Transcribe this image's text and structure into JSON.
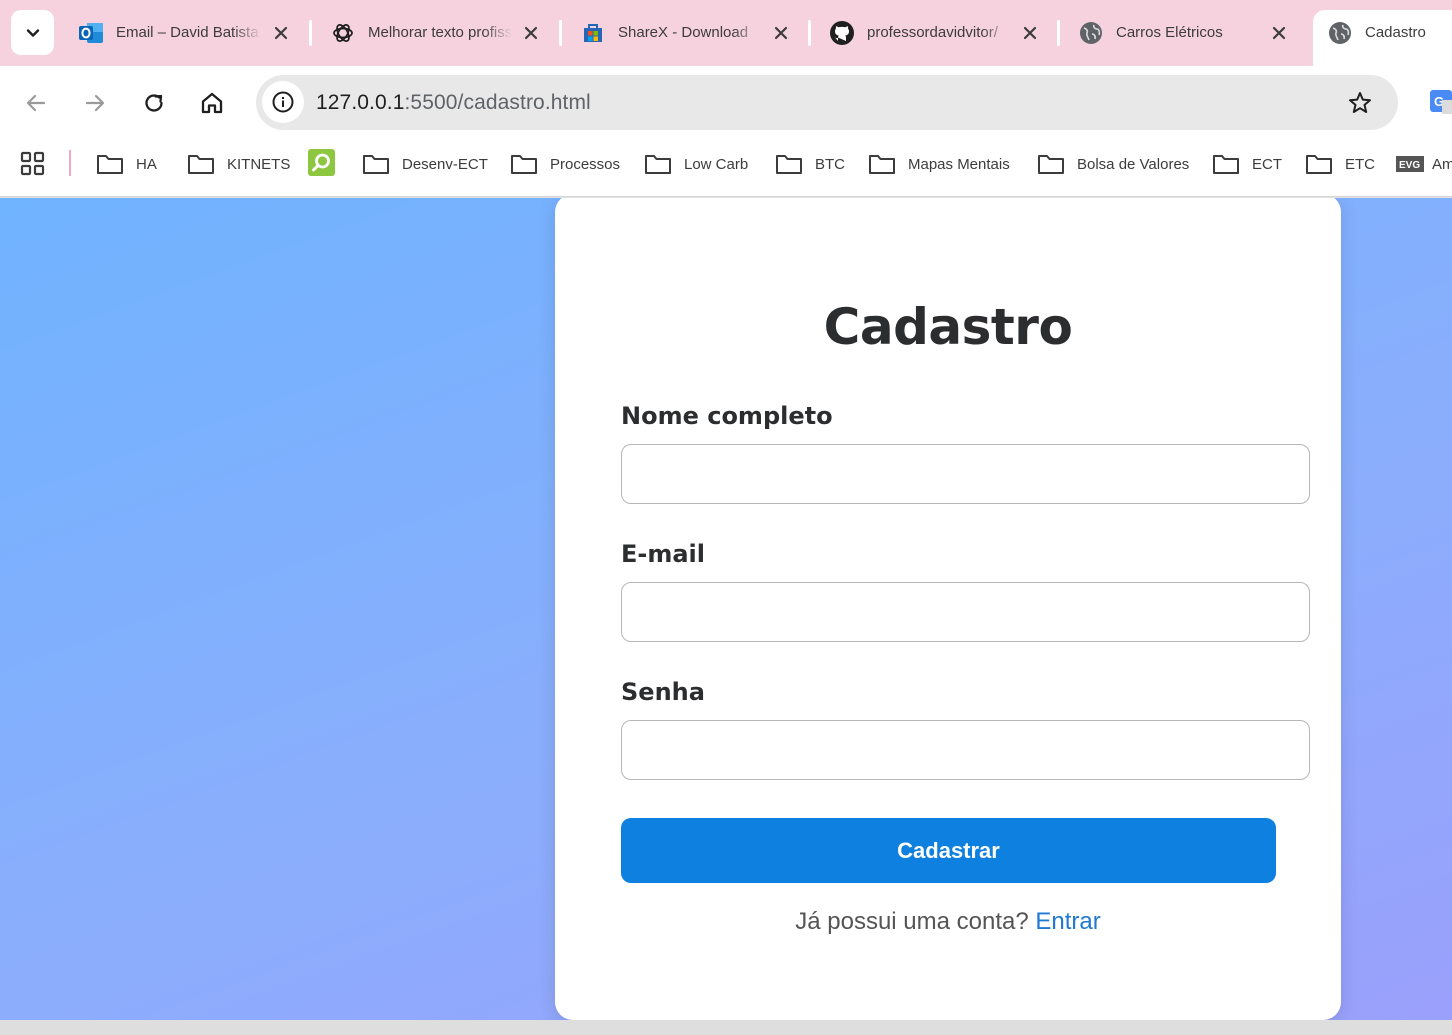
{
  "browser": {
    "tabs": [
      {
        "title": "Email – David Batista",
        "icon": "outlook-icon",
        "active": false
      },
      {
        "title": "Melhorar texto profissional",
        "icon": "chatgpt-icon",
        "active": false
      },
      {
        "title": "ShareX - Download",
        "icon": "ms-store-icon",
        "active": false
      },
      {
        "title": "professordavidvitor/",
        "icon": "github-icon",
        "active": false
      },
      {
        "title": "Carros Elétricos",
        "icon": "globe-icon",
        "active": false
      },
      {
        "title": "Cadastro",
        "icon": "globe-icon",
        "active": true
      }
    ],
    "url_host": "127.0.0.1",
    "url_path": ":5500/cadastro.html",
    "bookmarks": [
      {
        "label": "HA",
        "icon": "folder-icon"
      },
      {
        "label": "KITNETS",
        "icon": "folder-icon"
      },
      {
        "label": "",
        "icon": "green-search-icon"
      },
      {
        "label": "Desenv-ECT",
        "icon": "folder-icon"
      },
      {
        "label": "Processos",
        "icon": "folder-icon"
      },
      {
        "label": "Low Carb",
        "icon": "folder-icon"
      },
      {
        "label": "BTC",
        "icon": "folder-icon"
      },
      {
        "label": "Mapas Mentais",
        "icon": "folder-icon"
      },
      {
        "label": "Bolsa de Valores",
        "icon": "folder-icon"
      },
      {
        "label": "ECT",
        "icon": "folder-icon"
      },
      {
        "label": "ETC",
        "icon": "folder-icon"
      },
      {
        "label": "Am",
        "icon": "evg-icon"
      }
    ]
  },
  "form": {
    "title": "Cadastro",
    "fields": [
      {
        "label": "Nome completo",
        "value": ""
      },
      {
        "label": "E-mail",
        "value": ""
      },
      {
        "label": "Senha",
        "value": ""
      }
    ],
    "submit_label": "Cadastrar",
    "footer_prompt": "Já possui uma conta?",
    "footer_link": "Entrar"
  },
  "colors": {
    "tabstrip_bg": "#f6d2de",
    "button": "#0d80e0",
    "link": "#1f78d1",
    "gradient_start": "#70b3ff",
    "gradient_end": "#9aa0fb"
  }
}
